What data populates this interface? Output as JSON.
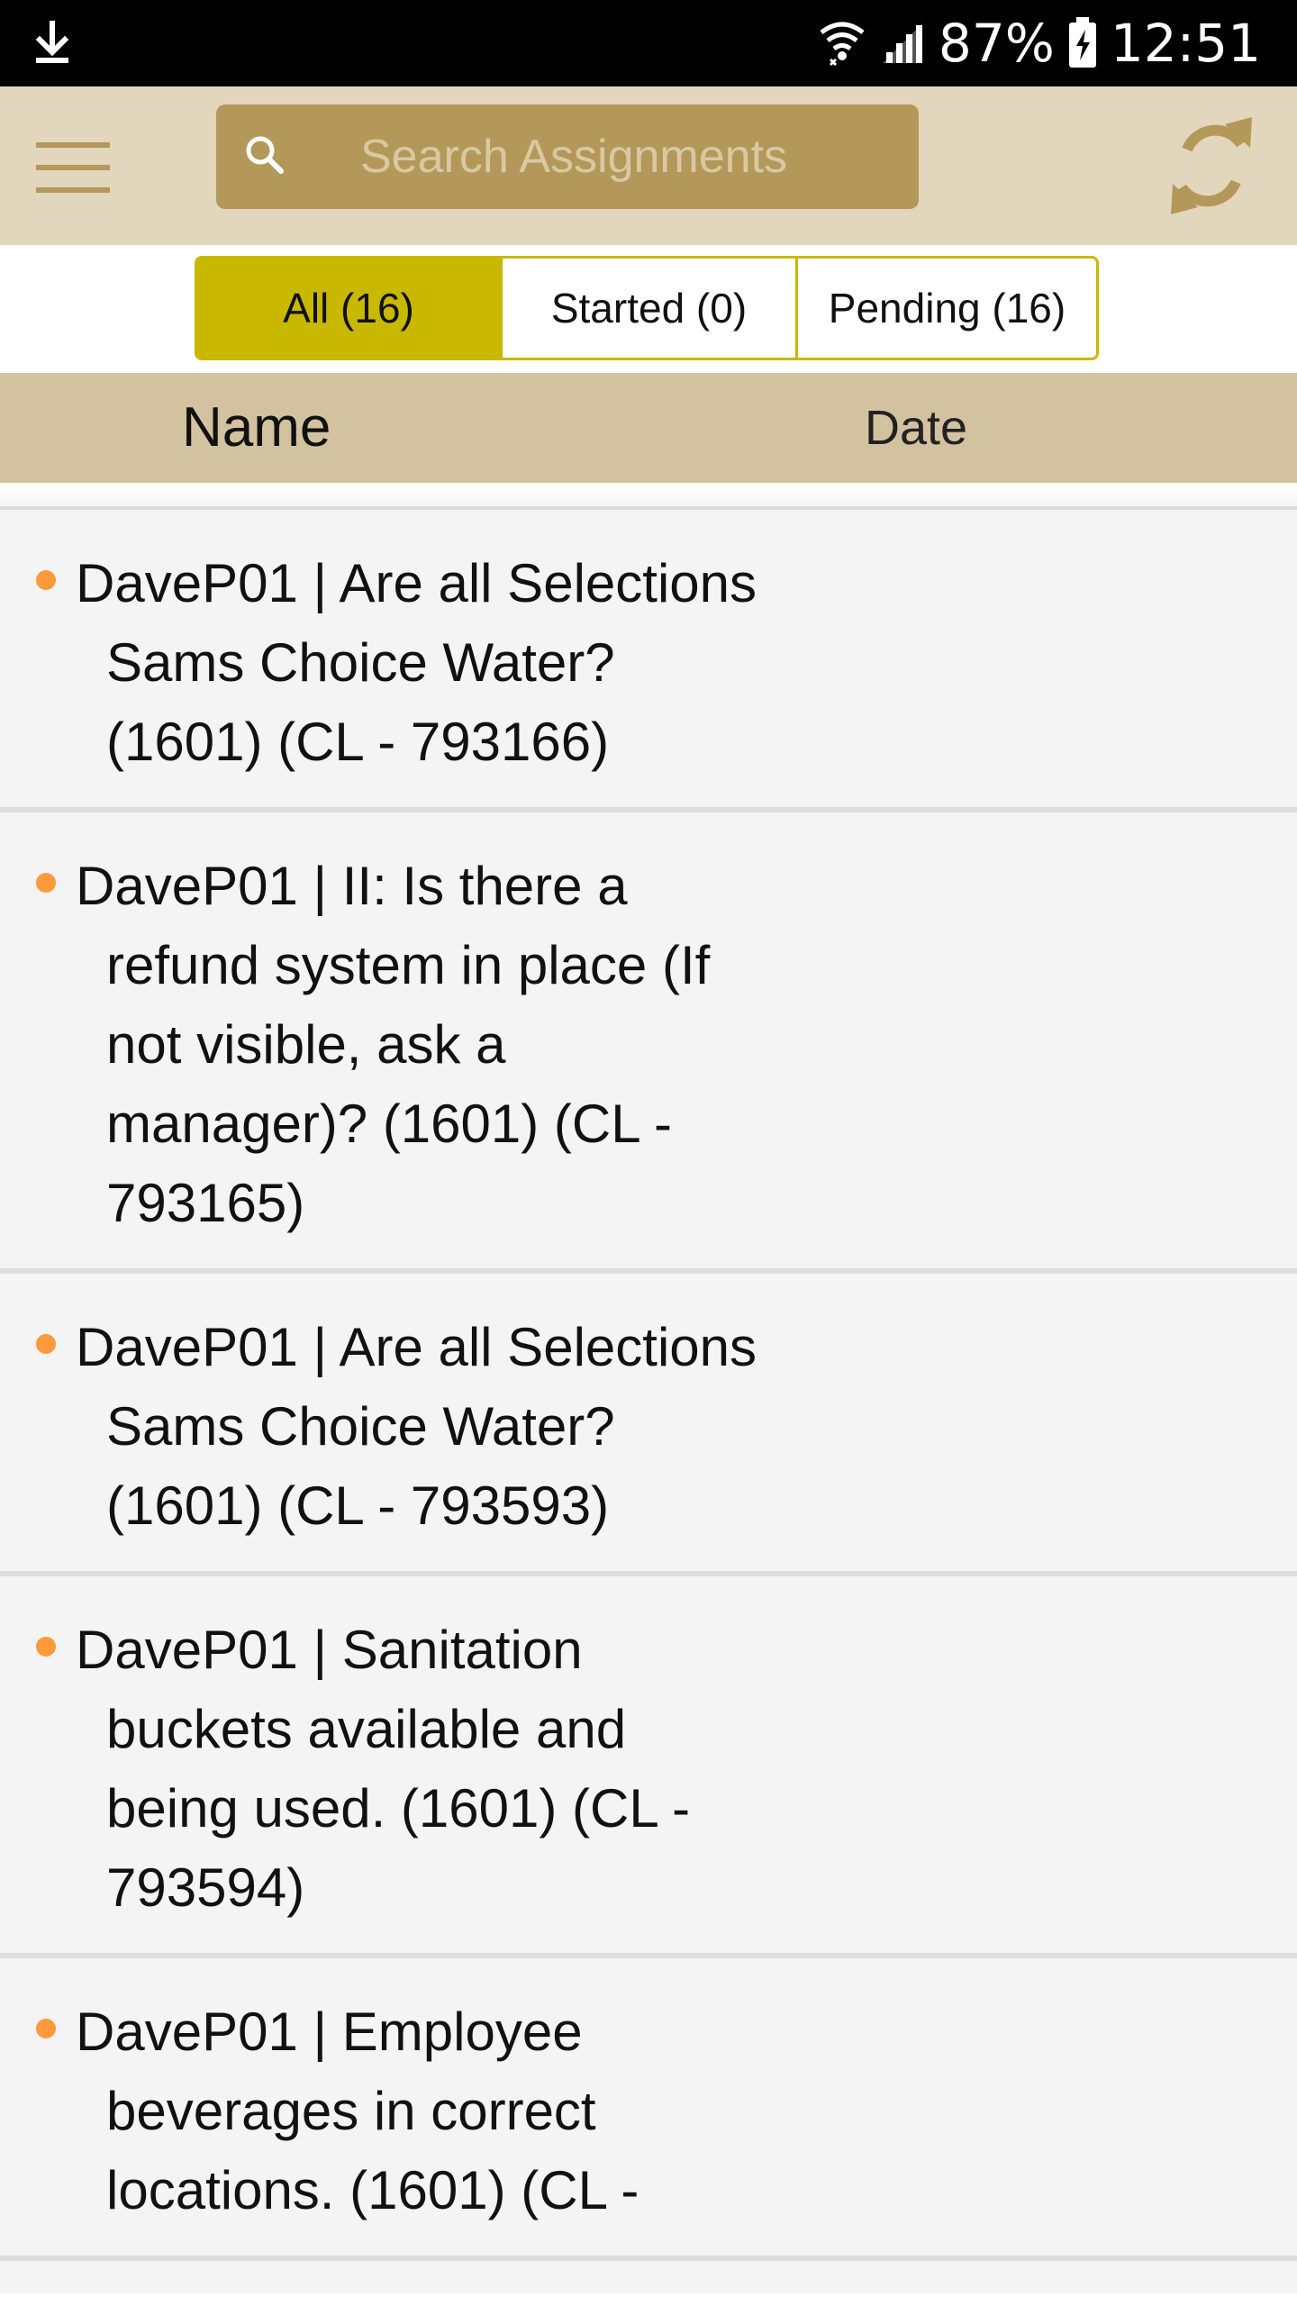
{
  "status_bar": {
    "battery": "87%",
    "time": "12:51",
    "icons": [
      "download-icon",
      "wifi-icon",
      "signal-icon",
      "battery-charging-icon"
    ]
  },
  "toolbar": {
    "menu_icon": "hamburger-menu-icon",
    "search": {
      "placeholder": "Search Assignments",
      "value": "",
      "icon": "search-icon"
    },
    "refresh_icon": "refresh-icon"
  },
  "filters": {
    "tabs": [
      {
        "label": "All (16)",
        "active": true
      },
      {
        "label": "Started (0)",
        "active": false
      },
      {
        "label": "Pending (16)",
        "active": false
      }
    ]
  },
  "columns": {
    "name": "Name",
    "date": "Date"
  },
  "assignments": [
    {
      "text": "DaveP01 | Are all Selections Sams Choice Water? (1601) (CL - 793166)",
      "date": ""
    },
    {
      "text": "DaveP01 | II: Is there a refund system in place (If not visible, ask a manager)? (1601) (CL - 793165)",
      "date": ""
    },
    {
      "text": "DaveP01 | Are all Selections Sams Choice Water? (1601) (CL - 793593)",
      "date": ""
    },
    {
      "text": "DaveP01 | Sanitation buckets available and being used. (1601) (CL - 793594)",
      "date": ""
    },
    {
      "text": "DaveP01 | Employee beverages in correct locations. (1601) (CL -",
      "date": ""
    }
  ],
  "colors": {
    "toolbar_bg": "#e2d6bc",
    "search_bg": "#b4985a",
    "accent": "#b4985a",
    "active_tab": "#c9b800",
    "header_bg": "#d3c29f",
    "bullet": "#ff9a3c"
  }
}
